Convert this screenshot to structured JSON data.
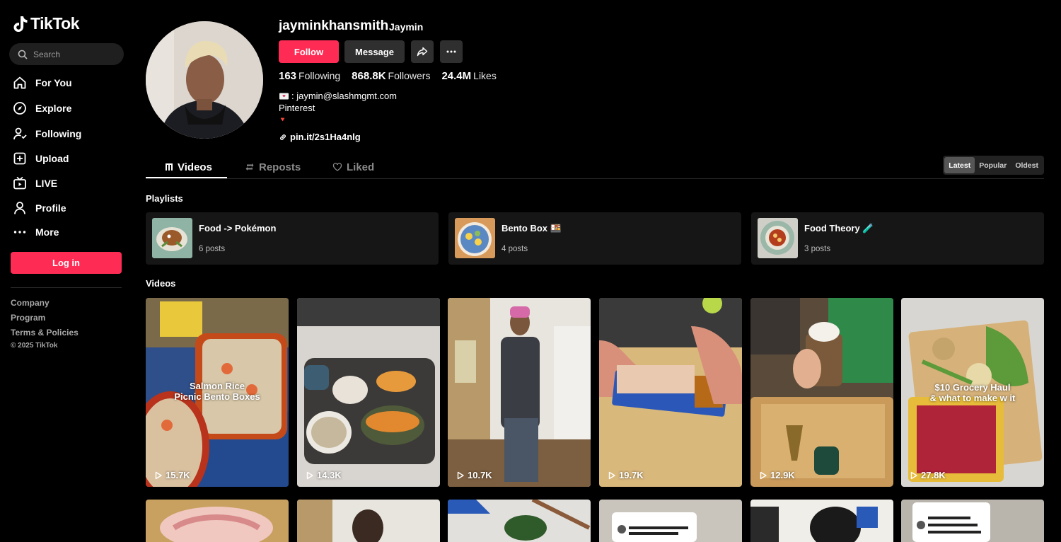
{
  "sidebar": {
    "logo_text": "TikTok",
    "search_placeholder": "Search",
    "nav": [
      {
        "label": "For You",
        "icon": "home-icon"
      },
      {
        "label": "Explore",
        "icon": "compass-icon"
      },
      {
        "label": "Following",
        "icon": "user-follow-icon"
      },
      {
        "label": "Upload",
        "icon": "plus-square-icon"
      },
      {
        "label": "LIVE",
        "icon": "live-tv-icon"
      },
      {
        "label": "Profile",
        "icon": "person-icon"
      },
      {
        "label": "More",
        "icon": "dots-icon"
      }
    ],
    "login_label": "Log in",
    "footer": {
      "company": "Company",
      "program": "Program",
      "terms": "Terms & Policies",
      "copyright": "© 2025 TikTok"
    }
  },
  "profile": {
    "username": "jayminkhansmith",
    "nickname": "Jaymin",
    "follow_label": "Follow",
    "message_label": "Message",
    "stats": {
      "following_count": "163",
      "following_label": "Following",
      "followers_count": "868.8K",
      "followers_label": "Followers",
      "likes_count": "24.4M",
      "likes_label": "Likes"
    },
    "bio": {
      "email_line": ": jaymin@slashmgmt.com",
      "line2": "Pinterest",
      "line3": "🔻"
    },
    "link": "pin.it/2s1Ha4nlg"
  },
  "tabs": {
    "videos": "Videos",
    "reposts": "Reposts",
    "liked": "Liked",
    "sort": [
      "Latest",
      "Popular",
      "Oldest"
    ],
    "active_sort": "Latest"
  },
  "playlists": {
    "heading": "Playlists",
    "items": [
      {
        "name": "Food -> Pokémon",
        "count": "6 posts"
      },
      {
        "name": "Bento Box 🍱",
        "count": "4 posts"
      },
      {
        "name": "Food Theory 🧪",
        "count": "3 posts"
      }
    ]
  },
  "videos": {
    "heading": "Videos",
    "items": [
      {
        "views": "15.7K",
        "caption": "Salmon Rice\nPicnic Bento Boxes"
      },
      {
        "views": "14.3K",
        "caption": ""
      },
      {
        "views": "10.7K",
        "caption": ""
      },
      {
        "views": "19.7K",
        "caption": ""
      },
      {
        "views": "12.9K",
        "caption": ""
      },
      {
        "views": "27.8K",
        "caption": "$10 Grocery Haul\n& what to make w it"
      }
    ]
  },
  "colors": {
    "accent": "#fe2c55",
    "background": "#000000",
    "button_gray": "#2f2f2f"
  }
}
